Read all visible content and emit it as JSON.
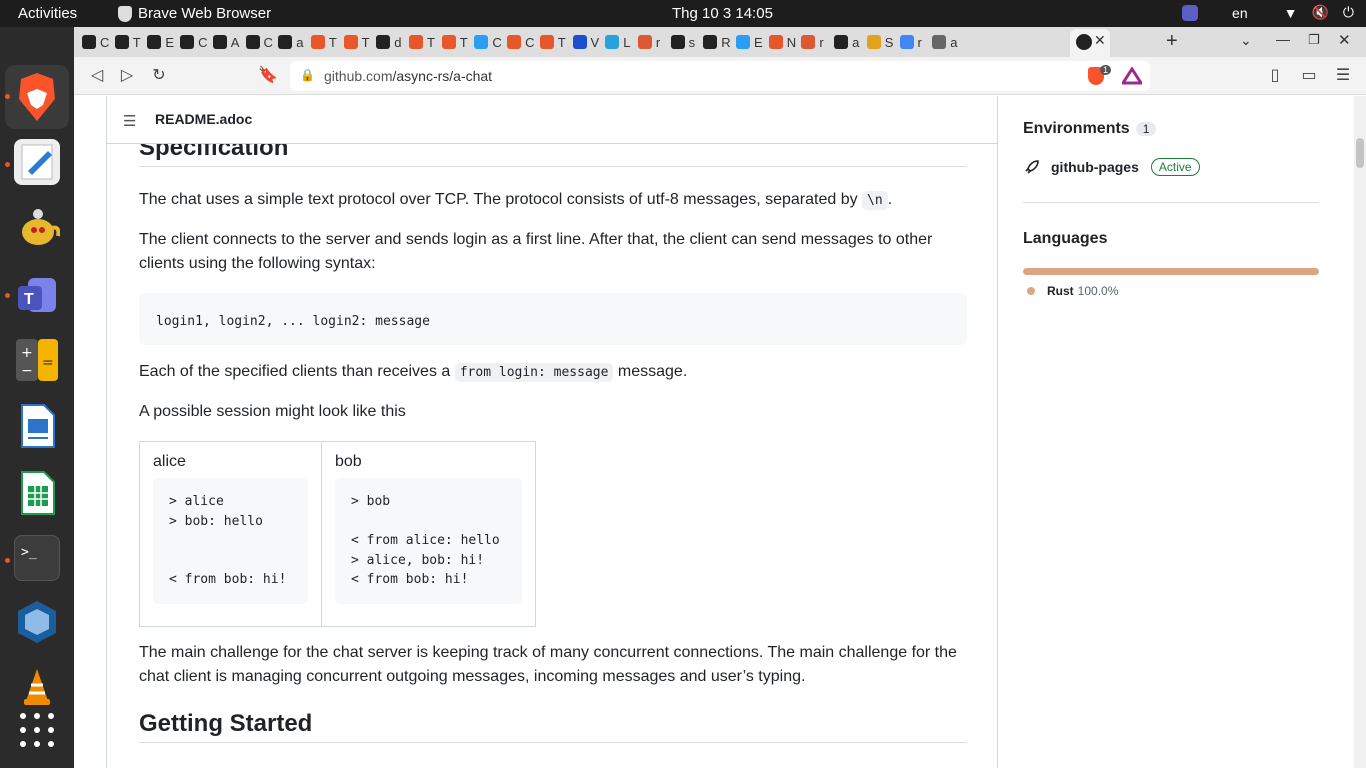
{
  "system": {
    "activities": "Activities",
    "app_name": "Brave Web Browser",
    "clock": "Thg 10 3  14:05",
    "lang": "en"
  },
  "browser": {
    "url_host": "github.com",
    "url_path": "/async-rs/a-chat",
    "shields_count": "1",
    "tab_letters": [
      "C",
      "T",
      "E",
      "C",
      "A",
      "C",
      "a",
      "T",
      "T",
      "d",
      "T",
      "T",
      "C",
      "C",
      "T",
      "V",
      "L",
      "r",
      "s",
      "R",
      "E",
      "N",
      "r",
      "a",
      "S",
      "r",
      "a"
    ]
  },
  "readme": {
    "filename": "README.adoc",
    "heading1": "Specification",
    "p1_text": "The chat uses a simple text protocol over TCP. The protocol consists of utf-8 messages, separated by ",
    "p1_code": "\\n",
    "p1_end": ".",
    "p2": "The client connects to the server and sends login as a first line. After that, the client can send messages to other clients using the following syntax:",
    "code_block": "login1, login2, ... login2: message",
    "p3_text": "Each of the specified clients than receives a ",
    "p3_code": "from login: message",
    "p3_end": " message.",
    "p4": "A possible session might look like this",
    "session": {
      "alice_name": "alice",
      "alice_log": "> alice\n> bob: hello\n\n\n< from bob: hi!",
      "bob_name": "bob",
      "bob_log": "> bob\n\n< from alice: hello\n> alice, bob: hi!\n< from bob: hi!"
    },
    "p5": "The main challenge for the chat server is keeping track of many concurrent connections. The main challenge for the chat client is managing concurrent outgoing messages, incoming messages and user’s typing.",
    "heading2": "Getting Started"
  },
  "sidebar": {
    "env_title": "Environments",
    "env_count": "1",
    "env_name": "github-pages",
    "env_status": "Active",
    "lang_title": "Languages",
    "lang_name": "Rust",
    "lang_pct": "100.0%",
    "lang_color": "#dea584"
  },
  "colors": {
    "brand": "#fb542b",
    "active_badge": "#1a7f37"
  }
}
